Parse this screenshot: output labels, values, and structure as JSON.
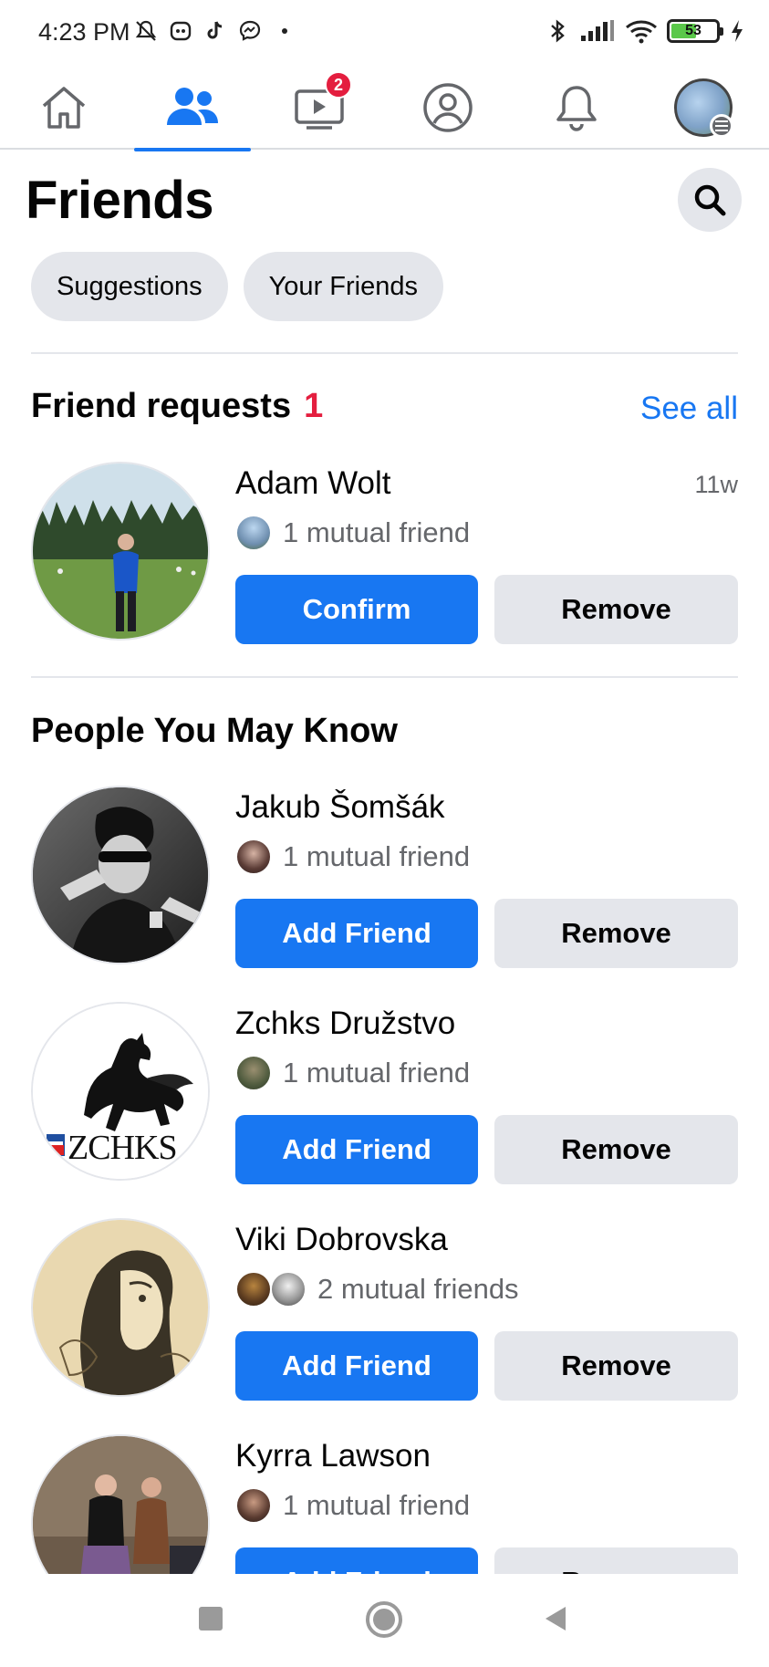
{
  "status_bar": {
    "time": "4:23 PM",
    "battery": "53",
    "left_icons": [
      "mute-icon",
      "app-icon",
      "tiktok-icon",
      "messenger-icon",
      "dot-icon"
    ],
    "right_icons": [
      "bluetooth-icon",
      "signal-icon",
      "wifi-icon",
      "battery-icon",
      "charging-icon"
    ]
  },
  "topnav": {
    "items": [
      {
        "name": "home-icon",
        "active": false
      },
      {
        "name": "friends-icon",
        "active": true
      },
      {
        "name": "video-icon",
        "active": false,
        "badge": "2"
      },
      {
        "name": "profile-icon",
        "active": false
      },
      {
        "name": "bell-icon",
        "active": false
      },
      {
        "name": "menu-avatar",
        "active": false
      }
    ],
    "accent": "#1877f2"
  },
  "header": {
    "title": "Friends",
    "search_icon": "search-icon"
  },
  "chips": [
    "Suggestions",
    "Your Friends"
  ],
  "requests": {
    "title": "Friend requests",
    "count": "1",
    "see_all": "See all",
    "items": [
      {
        "name": "Adam Wolt",
        "time": "11w",
        "mutual": "1 mutual friend",
        "primary": "Confirm",
        "secondary": "Remove"
      }
    ]
  },
  "pymk": {
    "title": "People You May Know",
    "items": [
      {
        "name": "Jakub Šomšák",
        "mutual": "1 mutual friend",
        "primary": "Add Friend",
        "secondary": "Remove"
      },
      {
        "name": "Zchks Družstvo",
        "mutual": "1 mutual friend",
        "primary": "Add Friend",
        "secondary": "Remove",
        "logo_text": "ZCHKS"
      },
      {
        "name": "Viki Dobrovska",
        "mutual": "2 mutual friends",
        "primary": "Add Friend",
        "secondary": "Remove"
      },
      {
        "name": "Kyrra Lawson",
        "mutual": "1 mutual friend",
        "primary": "Add Friend",
        "secondary": "Remove"
      }
    ]
  },
  "colors": {
    "primary": "#1877f2",
    "badge": "#e41e3f",
    "secondary_bg": "#e4e6eb",
    "muted_text": "#65676b"
  },
  "android_nav": [
    "recents-icon",
    "home-circle-icon",
    "back-icon"
  ]
}
